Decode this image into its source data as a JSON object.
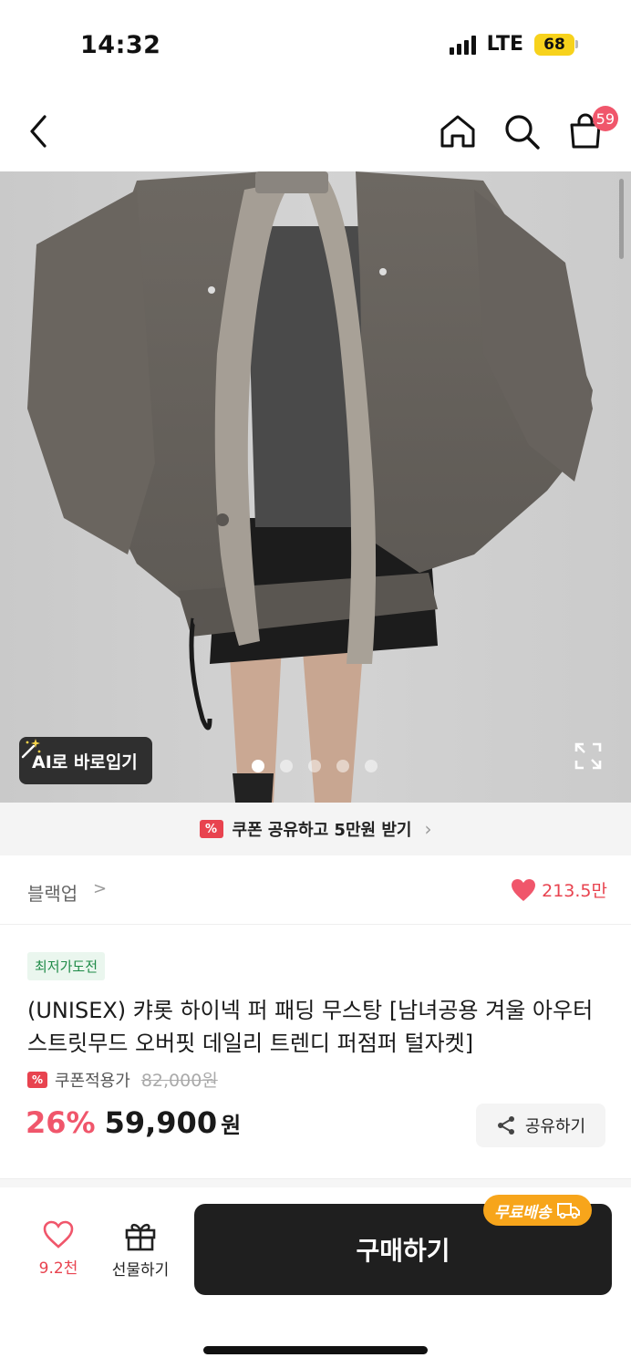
{
  "status_bar": {
    "time": "14:32",
    "network": "LTE",
    "battery": "68"
  },
  "nav": {
    "cart_count": "59"
  },
  "hero": {
    "ai_label": "AI로 바로입기",
    "slide_count": 5,
    "active_slide": 1
  },
  "coupon_banner": {
    "text": "쿠폰 공유하고 5만원 받기"
  },
  "brand": {
    "name": "블랙업",
    "chevron": ">",
    "likes": "213.5만"
  },
  "product": {
    "badge": "최저가도전",
    "title": "(UNISEX) 캬롯 하이넥 퍼 패딩 무스탕 [남녀공용 겨울 아우터 스트릿무드 오버핏 데일리 트렌디 퍼점퍼 털자켓]",
    "coupon_price_label": "쿠폰적용가",
    "original_price": "82,000원",
    "discount": "26%",
    "price": "59,900",
    "currency": "원",
    "share_label": "공유하기"
  },
  "bottom_bar": {
    "wish_count": "9.2천",
    "gift_label": "선물하기",
    "buy_label": "구매하기",
    "free_shipping": "무료배송"
  },
  "colors": {
    "accent": "#f0566b",
    "buy_button": "#1f1f1f",
    "free_ship": "#f7a51b"
  }
}
